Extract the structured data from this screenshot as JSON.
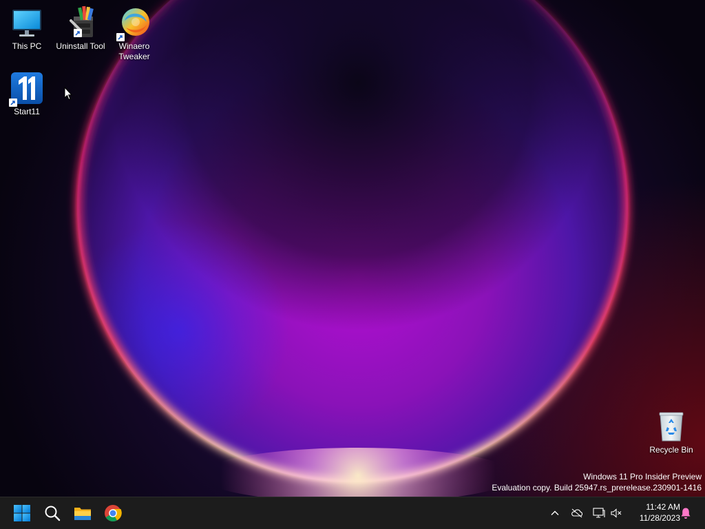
{
  "desktop_icons": {
    "this_pc": "This PC",
    "uninstall_tool": "Uninstall Tool",
    "winaero_tweaker_line1": "Winaero",
    "winaero_tweaker_line2": "Tweaker",
    "start11": "Start11",
    "recycle_bin": "Recycle Bin"
  },
  "watermark": {
    "line1": "Windows 11 Pro Insider Preview",
    "line2": "Evaluation copy. Build 25947.rs_prerelease.230901-1416"
  },
  "taskbar": {
    "pinned": [
      "start-icon",
      "search-icon",
      "file-explorer-icon",
      "chrome-icon"
    ],
    "tray_icons": [
      "chevron-up-icon",
      "onedrive-icon",
      "network-icon",
      "volume-muted-icon",
      "bell-icon"
    ],
    "clock": {
      "time": "11:42 AM",
      "date": "11/28/2023"
    }
  },
  "colors": {
    "taskbar_bg": "#1c1c1c",
    "windows_blue": "#0078d4",
    "wallpaper_dark": "#0a0616",
    "wallpaper_magenta": "#b010c8",
    "wallpaper_glow": "#ffd38a"
  }
}
